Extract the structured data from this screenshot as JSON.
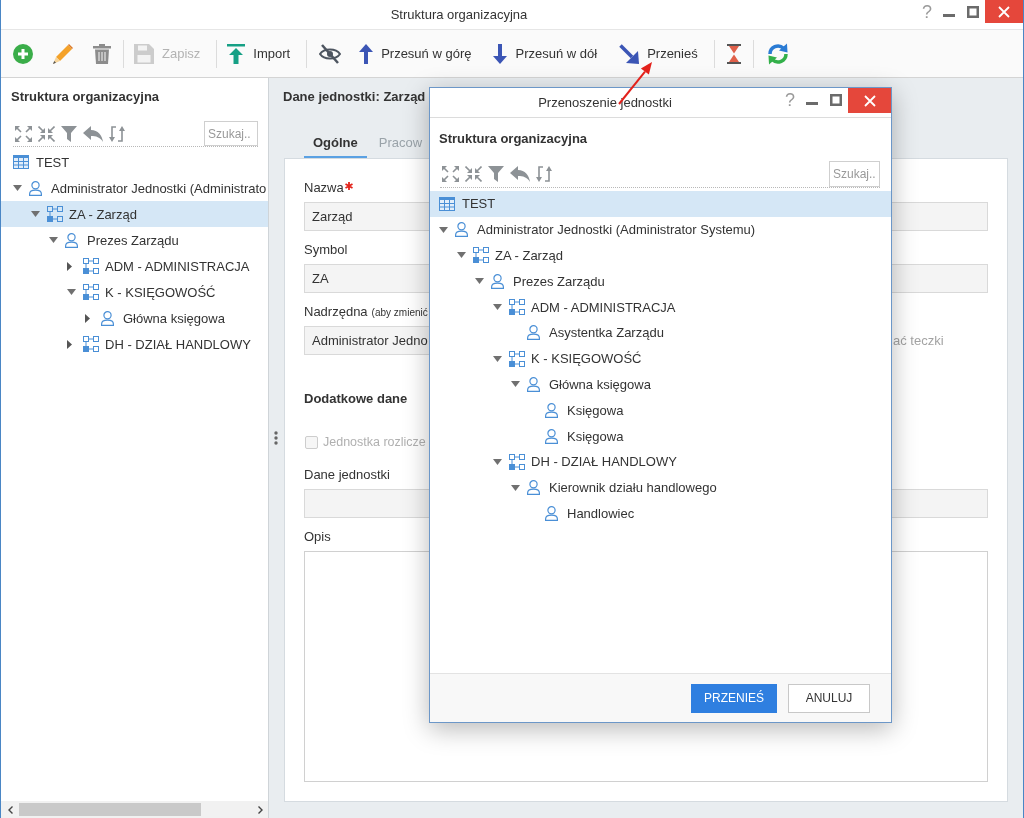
{
  "window": {
    "title": "Struktura organizacyjna",
    "help": "?"
  },
  "toolbar": [
    [
      {
        "kind": "add",
        "disabled": false
      },
      {
        "kind": "edit",
        "disabled": false
      },
      {
        "kind": "delete",
        "disabled": false
      }
    ],
    [
      {
        "kind": "save",
        "label": "Zapisz",
        "disabled": true
      }
    ],
    [
      {
        "kind": "import",
        "label": "Import",
        "disabled": false
      }
    ],
    [
      {
        "kind": "hide",
        "disabled": false
      },
      {
        "kind": "move_up",
        "label": "Przesuń w górę",
        "disabled": false
      },
      {
        "kind": "move_down",
        "label": "Przesuń w dół",
        "disabled": false
      },
      {
        "kind": "move",
        "label": "Przenieś",
        "disabled": false
      }
    ],
    [
      {
        "kind": "hourglass",
        "disabled": false
      }
    ],
    [
      {
        "kind": "refresh",
        "disabled": false
      }
    ]
  ],
  "left_panel": {
    "title": "Struktura organizacyjna",
    "search": {
      "placeholder": "Szukaj.."
    },
    "tree": [
      {
        "label": "TEST",
        "kind": "company",
        "selected": false
      },
      {
        "label": "Administrator Jednostki (Administrato",
        "kind": "person",
        "expanded": true,
        "selected": false,
        "children": [
          {
            "label": "ZA - Zarząd",
            "kind": "unit",
            "expanded": true,
            "selected": true,
            "children": [
              {
                "label": "Prezes Zarządu",
                "kind": "person",
                "expanded": true,
                "selected": false,
                "children": [
                  {
                    "label": "ADM - ADMINISTRACJA",
                    "kind": "unit",
                    "expanded": false,
                    "selected": false
                  },
                  {
                    "label": "K - KSIĘGOWOŚĆ",
                    "kind": "unit",
                    "expanded": true,
                    "selected": false,
                    "children": [
                      {
                        "label": "Główna księgowa",
                        "kind": "person",
                        "expanded": false,
                        "selected": false
                      }
                    ]
                  },
                  {
                    "label": "DH - DZIAŁ HANDLOWY",
                    "kind": "unit",
                    "expanded": false,
                    "selected": false
                  }
                ]
              }
            ]
          }
        ]
      }
    ]
  },
  "details": {
    "title": "Dane jednostki: Zarząd",
    "tabs": [
      {
        "label": "Ogólne",
        "selected": true
      },
      {
        "label": "Pracow",
        "selected": false
      }
    ],
    "name": {
      "label": "Nazwa",
      "required": true,
      "value": "Zarząd"
    },
    "symbol": {
      "label": "Symbol",
      "value": "ZA"
    },
    "parent": {
      "label": "Nadrzędna",
      "hint": "(aby zmienić",
      "value": "Administrator Jedno"
    },
    "side_text": "ać teczki",
    "section": "Dodatkowe dane",
    "settlement": {
      "label": "Jednostka rozlicze",
      "checked": false,
      "disabled": true
    },
    "unit_data": {
      "label": "Dane jednostki"
    },
    "description": {
      "label": "Opis"
    }
  },
  "dialog": {
    "title": "Przenoszenie jednostki",
    "help": "?",
    "heading": "Struktura organizacyjna",
    "search": {
      "placeholder": "Szukaj.."
    },
    "tree": [
      {
        "label": "TEST",
        "kind": "company",
        "selected": true
      },
      {
        "label": "Administrator Jednostki (Administrator Systemu)",
        "kind": "person",
        "expanded": true,
        "selected": false,
        "children": [
          {
            "label": "ZA - Zarząd",
            "kind": "unit",
            "expanded": true,
            "selected": false,
            "children": [
              {
                "label": "Prezes Zarządu",
                "kind": "person",
                "expanded": true,
                "selected": false,
                "children": [
                  {
                    "label": "ADM - ADMINISTRACJA",
                    "kind": "unit",
                    "expanded": true,
                    "selected": false,
                    "children": [
                      {
                        "label": "Asystentka Zarządu",
                        "kind": "person",
                        "selected": false
                      }
                    ]
                  },
                  {
                    "label": "K - KSIĘGOWOŚĆ",
                    "kind": "unit",
                    "expanded": true,
                    "selected": false,
                    "children": [
                      {
                        "label": "Główna księgowa",
                        "kind": "person",
                        "expanded": true,
                        "selected": false,
                        "children": [
                          {
                            "label": "Księgowa",
                            "kind": "person",
                            "selected": false
                          },
                          {
                            "label": "Księgowa",
                            "kind": "person",
                            "selected": false
                          }
                        ]
                      }
                    ]
                  },
                  {
                    "label": "DH - DZIAŁ HANDLOWY",
                    "kind": "unit",
                    "expanded": true,
                    "selected": false,
                    "children": [
                      {
                        "label": "Kierownik działu handlowego",
                        "kind": "person",
                        "expanded": true,
                        "selected": false,
                        "children": [
                          {
                            "label": "Handlowiec",
                            "kind": "person",
                            "selected": false
                          }
                        ]
                      }
                    ]
                  }
                ]
              }
            ]
          }
        ]
      }
    ],
    "buttons": [
      {
        "label": "PRZENIEŚ",
        "kind": "primary"
      },
      {
        "label": "ANULUJ",
        "kind": "secondary"
      }
    ]
  }
}
